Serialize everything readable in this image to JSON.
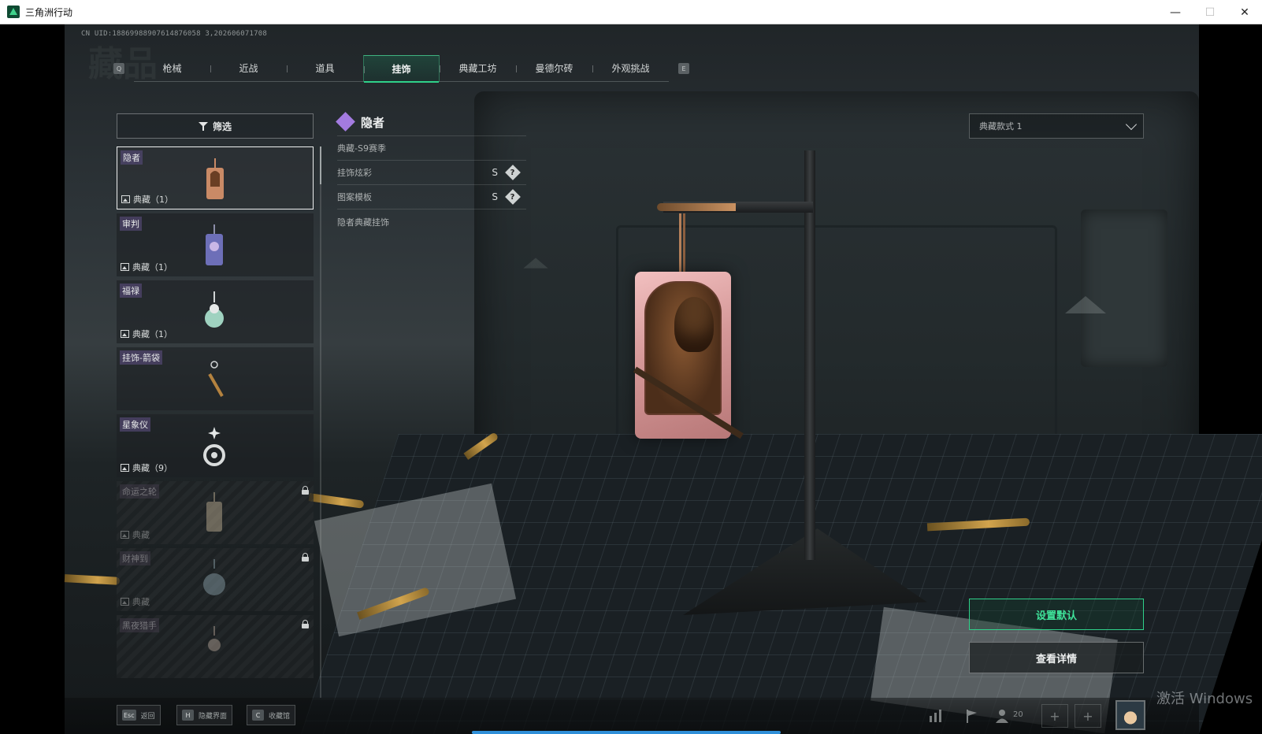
{
  "window": {
    "title": "三角洲行动",
    "controls": {
      "minimize": "—",
      "maximize": "☐",
      "close": "✕"
    }
  },
  "uid": "CN UID:18869988907614876058 3,202606071708",
  "tabs": {
    "left_key": "Q",
    "right_key": "E",
    "items": [
      {
        "label": "枪械",
        "active": false
      },
      {
        "label": "近战",
        "active": false
      },
      {
        "label": "道具",
        "active": false
      },
      {
        "label": "挂饰",
        "active": true
      },
      {
        "label": "典藏工坊",
        "active": false
      },
      {
        "label": "曼德尔砖",
        "active": false
      },
      {
        "label": "外观挑战",
        "active": false
      }
    ]
  },
  "filter": {
    "label": "筛选"
  },
  "items": [
    {
      "name": "隐者",
      "count": "典藏（1）",
      "selected": true,
      "locked": false,
      "thumb_color": "#c98a66"
    },
    {
      "name": "审判",
      "count": "典藏（1）",
      "selected": false,
      "locked": false,
      "thumb_color": "#6d6fb8"
    },
    {
      "name": "福禄",
      "count": "典藏（1）",
      "selected": false,
      "locked": false,
      "thumb_color": "#9fd2c0"
    },
    {
      "name": "挂饰-箭袋",
      "count": "",
      "selected": false,
      "locked": false,
      "thumb_color": "#b4823f"
    },
    {
      "name": "星象仪",
      "count": "典藏（9）",
      "selected": false,
      "locked": false,
      "thumb_color": "#d9dcdc"
    },
    {
      "name": "命运之轮",
      "count": "典藏",
      "selected": false,
      "locked": true,
      "thumb_color": "#c9b89a"
    },
    {
      "name": "财神到",
      "count": "典藏",
      "selected": false,
      "locked": true,
      "thumb_color": "#8fa6b0"
    },
    {
      "name": "黑夜猎手",
      "count": "",
      "selected": false,
      "locked": true,
      "thumb_color": "#b9a89a"
    }
  ],
  "detail": {
    "title": "隐者",
    "series": "典藏-S9赛季",
    "rows": [
      {
        "label": "挂饰炫彩",
        "grade": "S",
        "help": "?"
      },
      {
        "label": "图案模板",
        "grade": "S",
        "help": "?"
      }
    ],
    "description": "隐者典藏挂饰"
  },
  "style_select": {
    "value": "典藏款式 1"
  },
  "actions": {
    "set_default": "设置默认",
    "view_details": "查看详情"
  },
  "bottom_hints": [
    {
      "key": "Esc",
      "label": "返回"
    },
    {
      "key": "H",
      "label": "隐藏界面"
    },
    {
      "key": "C",
      "label": "收藏馆"
    }
  ],
  "tray": {
    "friends_count": "20",
    "plus": "+"
  },
  "watermark": "激活 Windows",
  "colors": {
    "accent": "#2fd18a",
    "rarity": "#a37be0",
    "progress": "#2f8fd8"
  }
}
